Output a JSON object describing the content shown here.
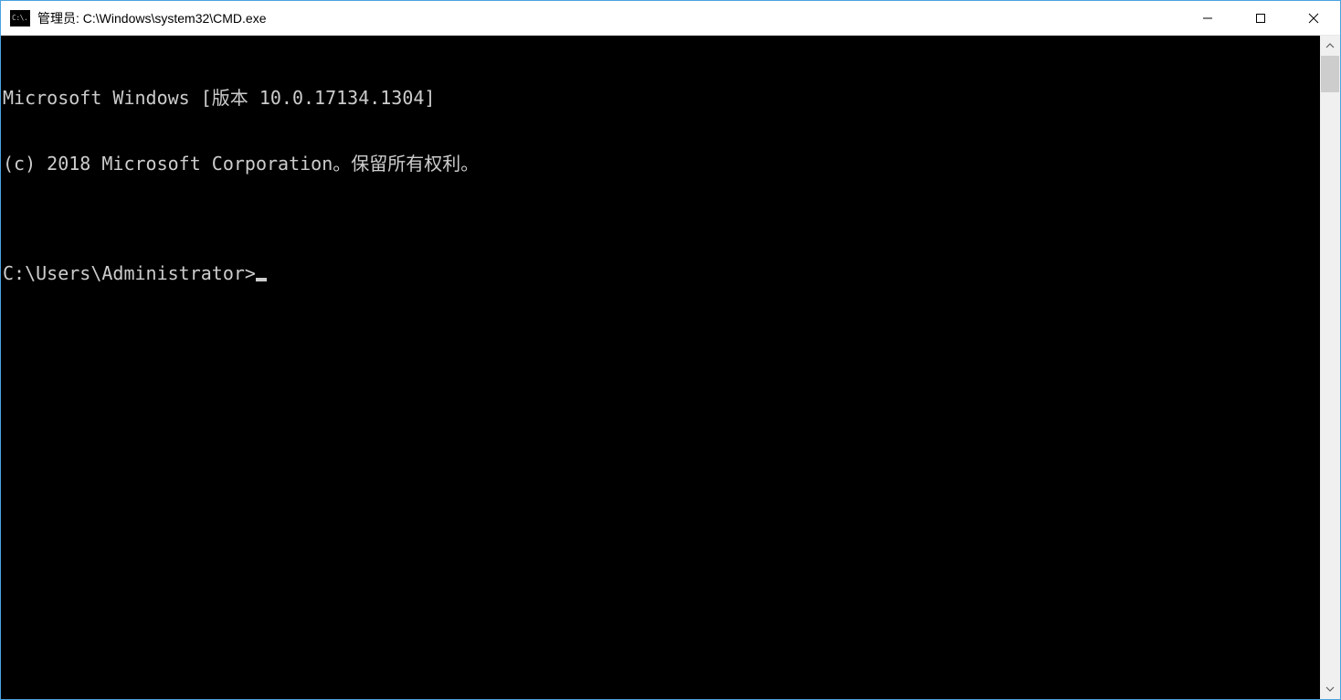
{
  "window": {
    "title": "管理员: C:\\Windows\\system32\\CMD.exe",
    "icon_text": "C:\\."
  },
  "terminal": {
    "line1": "Microsoft Windows [版本 10.0.17134.1304]",
    "line2": "(c) 2018 Microsoft Corporation。保留所有权利。",
    "blank": "",
    "prompt": "C:\\Users\\Administrator>"
  }
}
